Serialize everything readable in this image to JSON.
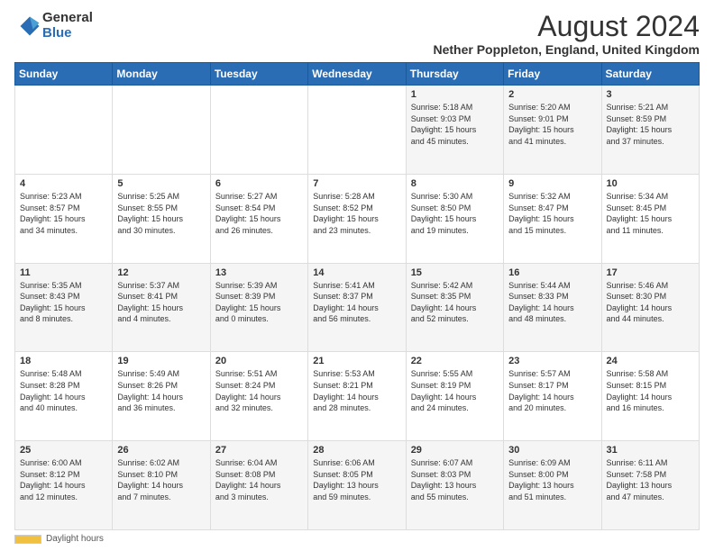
{
  "logo": {
    "general": "General",
    "blue": "Blue"
  },
  "title": "August 2024",
  "subtitle": "Nether Poppleton, England, United Kingdom",
  "days_of_week": [
    "Sunday",
    "Monday",
    "Tuesday",
    "Wednesday",
    "Thursday",
    "Friday",
    "Saturday"
  ],
  "footer": {
    "legend_label": "Daylight hours"
  },
  "weeks": [
    {
      "days": [
        {
          "number": "",
          "info": ""
        },
        {
          "number": "",
          "info": ""
        },
        {
          "number": "",
          "info": ""
        },
        {
          "number": "",
          "info": ""
        },
        {
          "number": "1",
          "info": "Sunrise: 5:18 AM\nSunset: 9:03 PM\nDaylight: 15 hours\nand 45 minutes."
        },
        {
          "number": "2",
          "info": "Sunrise: 5:20 AM\nSunset: 9:01 PM\nDaylight: 15 hours\nand 41 minutes."
        },
        {
          "number": "3",
          "info": "Sunrise: 5:21 AM\nSunset: 8:59 PM\nDaylight: 15 hours\nand 37 minutes."
        }
      ]
    },
    {
      "days": [
        {
          "number": "4",
          "info": "Sunrise: 5:23 AM\nSunset: 8:57 PM\nDaylight: 15 hours\nand 34 minutes."
        },
        {
          "number": "5",
          "info": "Sunrise: 5:25 AM\nSunset: 8:55 PM\nDaylight: 15 hours\nand 30 minutes."
        },
        {
          "number": "6",
          "info": "Sunrise: 5:27 AM\nSunset: 8:54 PM\nDaylight: 15 hours\nand 26 minutes."
        },
        {
          "number": "7",
          "info": "Sunrise: 5:28 AM\nSunset: 8:52 PM\nDaylight: 15 hours\nand 23 minutes."
        },
        {
          "number": "8",
          "info": "Sunrise: 5:30 AM\nSunset: 8:50 PM\nDaylight: 15 hours\nand 19 minutes."
        },
        {
          "number": "9",
          "info": "Sunrise: 5:32 AM\nSunset: 8:47 PM\nDaylight: 15 hours\nand 15 minutes."
        },
        {
          "number": "10",
          "info": "Sunrise: 5:34 AM\nSunset: 8:45 PM\nDaylight: 15 hours\nand 11 minutes."
        }
      ]
    },
    {
      "days": [
        {
          "number": "11",
          "info": "Sunrise: 5:35 AM\nSunset: 8:43 PM\nDaylight: 15 hours\nand 8 minutes."
        },
        {
          "number": "12",
          "info": "Sunrise: 5:37 AM\nSunset: 8:41 PM\nDaylight: 15 hours\nand 4 minutes."
        },
        {
          "number": "13",
          "info": "Sunrise: 5:39 AM\nSunset: 8:39 PM\nDaylight: 15 hours\nand 0 minutes."
        },
        {
          "number": "14",
          "info": "Sunrise: 5:41 AM\nSunset: 8:37 PM\nDaylight: 14 hours\nand 56 minutes."
        },
        {
          "number": "15",
          "info": "Sunrise: 5:42 AM\nSunset: 8:35 PM\nDaylight: 14 hours\nand 52 minutes."
        },
        {
          "number": "16",
          "info": "Sunrise: 5:44 AM\nSunset: 8:33 PM\nDaylight: 14 hours\nand 48 minutes."
        },
        {
          "number": "17",
          "info": "Sunrise: 5:46 AM\nSunset: 8:30 PM\nDaylight: 14 hours\nand 44 minutes."
        }
      ]
    },
    {
      "days": [
        {
          "number": "18",
          "info": "Sunrise: 5:48 AM\nSunset: 8:28 PM\nDaylight: 14 hours\nand 40 minutes."
        },
        {
          "number": "19",
          "info": "Sunrise: 5:49 AM\nSunset: 8:26 PM\nDaylight: 14 hours\nand 36 minutes."
        },
        {
          "number": "20",
          "info": "Sunrise: 5:51 AM\nSunset: 8:24 PM\nDaylight: 14 hours\nand 32 minutes."
        },
        {
          "number": "21",
          "info": "Sunrise: 5:53 AM\nSunset: 8:21 PM\nDaylight: 14 hours\nand 28 minutes."
        },
        {
          "number": "22",
          "info": "Sunrise: 5:55 AM\nSunset: 8:19 PM\nDaylight: 14 hours\nand 24 minutes."
        },
        {
          "number": "23",
          "info": "Sunrise: 5:57 AM\nSunset: 8:17 PM\nDaylight: 14 hours\nand 20 minutes."
        },
        {
          "number": "24",
          "info": "Sunrise: 5:58 AM\nSunset: 8:15 PM\nDaylight: 14 hours\nand 16 minutes."
        }
      ]
    },
    {
      "days": [
        {
          "number": "25",
          "info": "Sunrise: 6:00 AM\nSunset: 8:12 PM\nDaylight: 14 hours\nand 12 minutes."
        },
        {
          "number": "26",
          "info": "Sunrise: 6:02 AM\nSunset: 8:10 PM\nDaylight: 14 hours\nand 7 minutes."
        },
        {
          "number": "27",
          "info": "Sunrise: 6:04 AM\nSunset: 8:08 PM\nDaylight: 14 hours\nand 3 minutes."
        },
        {
          "number": "28",
          "info": "Sunrise: 6:06 AM\nSunset: 8:05 PM\nDaylight: 13 hours\nand 59 minutes."
        },
        {
          "number": "29",
          "info": "Sunrise: 6:07 AM\nSunset: 8:03 PM\nDaylight: 13 hours\nand 55 minutes."
        },
        {
          "number": "30",
          "info": "Sunrise: 6:09 AM\nSunset: 8:00 PM\nDaylight: 13 hours\nand 51 minutes."
        },
        {
          "number": "31",
          "info": "Sunrise: 6:11 AM\nSunset: 7:58 PM\nDaylight: 13 hours\nand 47 minutes."
        }
      ]
    }
  ]
}
